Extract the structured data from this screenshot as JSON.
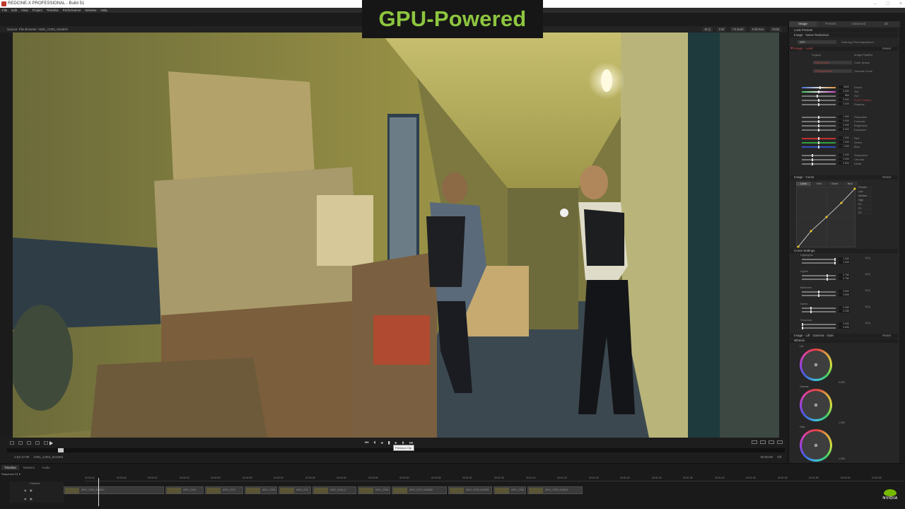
{
  "window": {
    "title": "REDCINE-X PROFESSIONAL - Build 51",
    "controls": [
      "–",
      "□",
      "×"
    ]
  },
  "menu": [
    "File",
    "Edit",
    "View",
    "Project",
    "Timeline",
    "Performance",
    "Window",
    "Help"
  ],
  "overlay": {
    "caption": "GPU-Powered",
    "caption_color": "#8dc63f"
  },
  "viewer": {
    "source_label": "Source: File Browser: A001_C004_0415K0",
    "header_controls": [
      "M Q",
      "Full",
      "Fit Both",
      "Full Res",
      "RGB"
    ]
  },
  "transport": {
    "tooltip": "Previous Clip",
    "center_controls": [
      "⏮",
      "⏴",
      "◂",
      "▮",
      "▸",
      "⏵",
      "⏭"
    ],
    "tc_left": "1:54:17:00",
    "tc_mid": "A001_C004_0415K0",
    "tc_right": [
      "00:00:00",
      "Off"
    ]
  },
  "inspector": {
    "tabs": [
      "Image",
      "Presets",
      "Advanced",
      "3D"
    ],
    "sections": {
      "look_presets": "Look Presets",
      "noise_reduction": "Image · Noise Reduction",
      "olpf": "OFF",
      "flashing_pixel": "Flashing Pixel Adjustment",
      "image_look": "Image · Look",
      "legacy": "Legacy",
      "image_pipeline": "Image Pipeline",
      "color_space": "Color Space",
      "red_color": "REDColor4",
      "gamma_curve": "Gamma Curve",
      "gamma_value": "REDgamma4",
      "image_curve": "Image · Curve",
      "curve_settings": "Curve Settings",
      "image_lgg": "Image · Lift · Gamma · Gain",
      "wheels": "Wheels",
      "reset": "Reset"
    },
    "sliders": [
      {
        "label": "Kelvin",
        "value": "5600",
        "frac": 0.55
      },
      {
        "label": "Tint",
        "value": "0.000",
        "frac": 0.5
      },
      {
        "label": "ISO",
        "value": "800",
        "frac": 0.45
      },
      {
        "label": "FLUT Control",
        "value": "0.000",
        "frac": 0.5
      },
      {
        "label": "Shadow",
        "value": "0.000",
        "frac": 0.5
      },
      {
        "label": "Saturation",
        "value": "1.000",
        "frac": 0.5
      },
      {
        "label": "Contrast",
        "value": "0.000",
        "frac": 0.5
      },
      {
        "label": "Brightness",
        "value": "0.000",
        "frac": 0.5
      },
      {
        "label": "Exposure",
        "value": "0.000",
        "frac": 0.5
      },
      {
        "label": "Red",
        "value": "1.000",
        "frac": 0.5
      },
      {
        "label": "Green",
        "value": "1.000",
        "frac": 0.5
      },
      {
        "label": "Blue",
        "value": "1.000",
        "frac": 0.5
      },
      {
        "label": "Sharpness",
        "value": "0.000",
        "frac": 0.3
      },
      {
        "label": "Chroma",
        "value": "0.000",
        "frac": 0.3
      },
      {
        "label": "Detail",
        "value": "0.000",
        "frac": 0.3
      }
    ],
    "curve_tabs": [
      "Luma",
      "Red",
      "Green",
      "Blue"
    ],
    "curve_options": [
      "Presets",
      "Low",
      "Medium",
      "High",
      "P1",
      "P2",
      "P3"
    ],
    "curve_groups": [
      {
        "label": "Highlights",
        "values": [
          "1.000",
          "1.000"
        ]
      },
      {
        "label": "Lights",
        "values": [
          "0.750",
          "0.750"
        ]
      },
      {
        "label": "Midtones",
        "values": [
          "0.500",
          "0.500"
        ]
      },
      {
        "label": "Darks",
        "values": [
          "0.250",
          "0.250"
        ]
      },
      {
        "label": "Shadows",
        "values": [
          "0.000",
          "0.000"
        ]
      }
    ],
    "wheel_labels": [
      "Lift",
      "Gamma",
      "Gain"
    ],
    "wheel_values": [
      "0.000",
      "1.000",
      "1.000"
    ]
  },
  "timeline": {
    "tabs": [
      "Timeline",
      "Markers",
      "Audio"
    ],
    "sequence": "Sequence 01 ▾",
    "ruler": [
      "00:00:00",
      "00:00:05",
      "00:00:10",
      "00:00:15",
      "00:00:20",
      "00:00:25",
      "00:00:30",
      "00:00:35",
      "00:00:40",
      "00:00:45",
      "00:00:50",
      "00:00:55",
      "00:01:00",
      "00:01:05",
      "00:01:10",
      "00:01:15",
      "00:01:20",
      "00:01:25",
      "00:01:30",
      "00:01:35",
      "00:01:40",
      "00:01:45",
      "00:01:50",
      "00:01:55",
      "00:02:00",
      "00:02:05"
    ],
    "track_label": "Content",
    "clips": [
      {
        "label": "A001_C004_0415K0",
        "width_frac": 0.18
      },
      {
        "label": "A001_C011",
        "width_frac": 0.07
      },
      {
        "label": "A001_C017",
        "width_frac": 0.07
      },
      {
        "label": "A001_C025",
        "width_frac": 0.06
      },
      {
        "label": "A001_C03",
        "width_frac": 0.06
      },
      {
        "label": "A001_C044_0",
        "width_frac": 0.08
      },
      {
        "label": "A001_C050",
        "width_frac": 0.06
      },
      {
        "label": "A001_C072_0415AB",
        "width_frac": 0.1
      },
      {
        "label": "A001_C078_0415S5",
        "width_frac": 0.08
      },
      {
        "label": "A001_C082",
        "width_frac": 0.06
      },
      {
        "label": "A001_C093_0415K4",
        "width_frac": 0.1
      }
    ],
    "brand": "NVIDIA"
  }
}
